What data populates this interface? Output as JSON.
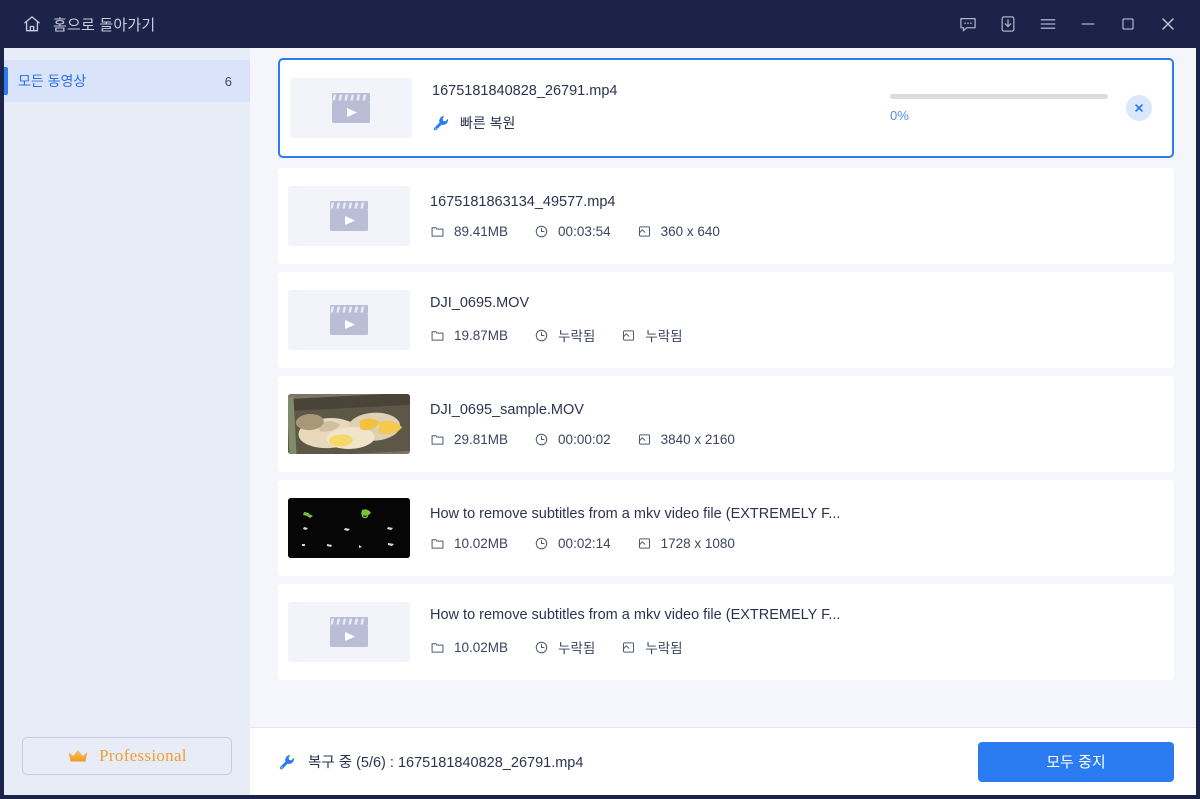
{
  "window": {
    "home_label": "홈으로 돌아가기",
    "home_icon": "home-icon",
    "controls": [
      {
        "name": "feedback-icon",
        "label": "피드백"
      },
      {
        "name": "download-icon",
        "label": "다운로드"
      },
      {
        "name": "menu-icon",
        "label": "메뉴"
      },
      {
        "name": "minimize-icon",
        "label": "최소화"
      },
      {
        "name": "maximize-icon",
        "label": "최대화"
      },
      {
        "name": "close-icon",
        "label": "닫기"
      }
    ]
  },
  "sidebar": {
    "items": [
      {
        "label": "모든 동영상",
        "count": "6",
        "active": true
      }
    ],
    "pro_button": {
      "label": "Professional",
      "icon": "crown-icon"
    }
  },
  "colors": {
    "titlebar_bg": "#1b2349",
    "sidebar_bg": "#e8ecf7",
    "main_bg": "#f4f6fb",
    "accent_blue": "#2b7cf0",
    "pro_orange": "#f0a032",
    "row_white": "#ffffff"
  },
  "main": {
    "rows": [
      {
        "file_name": "1675181840828_26791.mp4",
        "selected": true,
        "thumb": "film-placeholder",
        "repair_tag": {
          "icon": "wrench-icon",
          "label": "빠른 복원"
        },
        "progress": {
          "percent_label": "0%",
          "percent_value": 0
        },
        "cancel_icon": "close-icon"
      },
      {
        "file_name": "1675181863134_49577.mp4",
        "selected": false,
        "thumb": "film-placeholder",
        "meta": [
          {
            "icon": "file-icon",
            "value": "89.41MB"
          },
          {
            "icon": "clock-icon",
            "value": "00:03:54"
          },
          {
            "icon": "resolution-icon",
            "value": "360 x 640"
          }
        ]
      },
      {
        "file_name": "DJI_0695.MOV",
        "selected": false,
        "thumb": "film-placeholder",
        "meta": [
          {
            "icon": "file-icon",
            "value": "19.87MB"
          },
          {
            "icon": "clock-icon",
            "value": "누락됨"
          },
          {
            "icon": "resolution-icon",
            "value": "누락됨"
          }
        ]
      },
      {
        "file_name": "DJI_0695_sample.MOV",
        "selected": false,
        "thumb": "glitch-food",
        "meta": [
          {
            "icon": "file-icon",
            "value": "29.81MB"
          },
          {
            "icon": "clock-icon",
            "value": "00:00:02"
          },
          {
            "icon": "resolution-icon",
            "value": "3840 x 2160"
          }
        ]
      },
      {
        "file_name": "How to remove subtitles from a mkv video file (EXTREMELY F...",
        "selected": false,
        "thumb": "dark-frame",
        "meta": [
          {
            "icon": "file-icon",
            "value": "10.02MB"
          },
          {
            "icon": "clock-icon",
            "value": "00:02:14"
          },
          {
            "icon": "resolution-icon",
            "value": "1728 x 1080"
          }
        ]
      },
      {
        "file_name": "How to remove subtitles from a mkv video file (EXTREMELY F...",
        "selected": false,
        "thumb": "film-placeholder",
        "meta": [
          {
            "icon": "file-icon",
            "value": "10.02MB"
          },
          {
            "icon": "clock-icon",
            "value": "누락됨"
          },
          {
            "icon": "resolution-icon",
            "value": "누락됨"
          }
        ]
      }
    ]
  },
  "bottombar": {
    "status_icon": "wrench-icon",
    "status_text": "복구 중 (5/6) : 1675181840828_26791.mp4",
    "stop_button": "모두 중지"
  }
}
